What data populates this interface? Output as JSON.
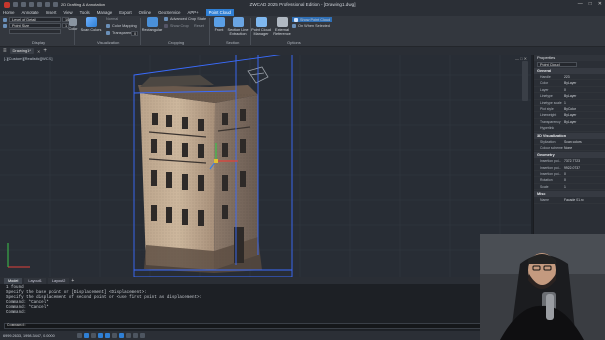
{
  "window": {
    "title": "ZWCAD 2025 Professional Edition - [Drawing1.dwg]",
    "workspace": "2D Drafting & Annotation",
    "minimize": "—",
    "maximize": "□",
    "close": "✕"
  },
  "menu": [
    "Home",
    "Annotate",
    "Insert",
    "View",
    "Tools",
    "Manage",
    "Export",
    "Online",
    "GeoService",
    "APP+",
    "Point Cloud"
  ],
  "menu_active": "Point Cloud",
  "ribbon": {
    "lod_label": "Level of Detail",
    "lod_value": "10",
    "point_size_label": "Point Size",
    "point_size_value": "1",
    "color_label": "Color",
    "scan_colors": "Scan Colors",
    "normal": "Normal",
    "color_mapping": "Color Mapping",
    "transparency": "Transparency",
    "transparency_value": "0",
    "rectangular": "Rectangular",
    "advanced_crop_state": "Advanced Crop State",
    "show_crop": "Show Crop",
    "reset": "Reset",
    "front": "Front",
    "section_line_extraction": "Section Line Extraction",
    "point_cloud_manager": "Point Cloud Manager",
    "external_reference": "External Reference",
    "show_point_cloud": "Show Point Cloud",
    "on_when_selected": "On When Selected",
    "groups": {
      "display": "Display",
      "visualization": "Visualization",
      "cropping": "Cropping",
      "section": "Section",
      "options": "Options"
    }
  },
  "doc_tab": "Drawing1*",
  "viewport_label": "[-][Custom][Realistic][WCS]",
  "properties": {
    "title": "Properties",
    "selection": "Point Cloud",
    "sections": [
      {
        "name": "General",
        "rows": [
          [
            "Handle",
            "223"
          ],
          [
            "Color",
            "ByLayer"
          ],
          [
            "Layer",
            "0"
          ],
          [
            "Linetype",
            "ByLayer"
          ],
          [
            "Linetype scale",
            "1"
          ],
          [
            "Plot style",
            "ByColor"
          ],
          [
            "Lineweight",
            "ByLayer"
          ],
          [
            "Transparency",
            "ByLayer"
          ],
          [
            "Hyperlink",
            ""
          ]
        ]
      },
      {
        "name": "3D Visualization",
        "rows": [
          [
            "Stylization",
            "Scan colors"
          ],
          [
            "Colour scheme",
            "None"
          ]
        ]
      },
      {
        "name": "Geometry",
        "rows": [
          [
            "Insertion poi...",
            "7372.7723"
          ],
          [
            "Insertion poi...",
            "9922.0737"
          ],
          [
            "Insertion poi...",
            "0"
          ],
          [
            "Rotation",
            "0"
          ],
          [
            "Scale",
            "1"
          ]
        ]
      },
      {
        "name": "Misc",
        "rows": [
          [
            "Name",
            "Facade 01.rc"
          ]
        ]
      }
    ]
  },
  "layout_tabs": [
    "Model",
    "Layout1",
    "Layout2"
  ],
  "layout_active": "Model",
  "command_history": [
    "1 found",
    "Specify the base point or [Displacement] <Displacement>:",
    "Specify the displacement of second point or <use first point as displacement>:",
    "Command: *Cancel*",
    "Command: *Cancel*",
    "Command:"
  ],
  "command_prompt": "Command:",
  "status": {
    "coords": "6999.2633, 1998.3447, 0.0000"
  },
  "colors": {
    "accent": "#2f7fd4",
    "ucs_x": "#e0413a",
    "ucs_y": "#3cc24a",
    "ucs_z": "#3a7fe0",
    "selection": "#3a6cff"
  }
}
